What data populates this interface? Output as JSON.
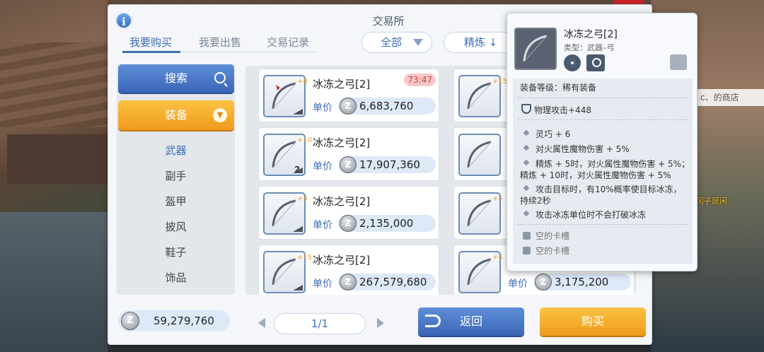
{
  "background": {
    "shop_label": "c、的商店",
    "npc_label": "闰子居闲"
  },
  "panel": {
    "title": "交易所",
    "tabs": [
      {
        "label": "我要购买",
        "active": true
      },
      {
        "label": "我要出售",
        "active": false
      },
      {
        "label": "交易记录",
        "active": false
      }
    ],
    "filter_all": "全部",
    "sort_refine": "精炼 ↓"
  },
  "sidebar": {
    "search_label": "搜索",
    "equip_label": "装备",
    "categories": [
      {
        "label": "武器",
        "active": true
      },
      {
        "label": "副手",
        "active": false
      },
      {
        "label": "盔甲",
        "active": false
      },
      {
        "label": "披风",
        "active": false
      },
      {
        "label": "鞋子",
        "active": false
      },
      {
        "label": "饰品",
        "active": false
      }
    ]
  },
  "listings": [
    {
      "name": "冰冻之弓[2]",
      "refine": "+8",
      "price_label": "单价",
      "price": "6,683,760",
      "timer": "73:47"
    },
    {
      "name": "冰冻之弓[2]",
      "refine": "+10",
      "slot": "2",
      "price_label": "单价",
      "price": "17,907,360"
    },
    {
      "name": "冰冻之弓[2]",
      "refine": "+3",
      "price_label": "单价",
      "price": "2,135,000"
    },
    {
      "name": "冰冻之弓[2]",
      "refine": "+15",
      "price_label": "单价",
      "price": "267,579,680"
    },
    {
      "name": "",
      "refine": "+15"
    },
    {
      "name": "",
      "refine": ""
    },
    {
      "name": "",
      "refine": "+5"
    },
    {
      "name": "",
      "refine": "+6",
      "price_label": "单价",
      "price": "3,175,200"
    }
  ],
  "footer": {
    "balance": "59,279,760",
    "page": "1/1",
    "back_label": "返回",
    "buy_label": "购买"
  },
  "tooltip": {
    "name": "冰冻之弓[2]",
    "type": "类型：武器–弓",
    "grade": "装备等级：稀有装备",
    "attack": "物理攻击+448",
    "effects": [
      "灵巧 + 6",
      "对火属性魔物伤害 + 5%",
      "精炼 + 5时，对火属性魔物伤害 + 5%；",
      "精炼 + 10时，对火属性魔物伤害 + 5%",
      "攻击目标时，有10%概率使目标冰冻，",
      "持续2秒",
      "攻击冰冻单位时不会打破冰冻"
    ],
    "slots": [
      "空的卡槽",
      "空的卡槽"
    ]
  },
  "colors": {
    "accent_blue": "#3e6fb5",
    "accent_orange": "#f09b1c"
  }
}
